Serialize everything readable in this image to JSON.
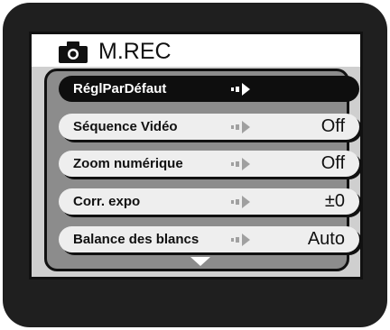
{
  "header": {
    "title": "M.REC",
    "icon": "camera-icon"
  },
  "menu": {
    "items": [
      {
        "label": "RéglParDéfaut",
        "value": "",
        "selected": true
      },
      {
        "label": "Séquence Vidéo",
        "value": "Off",
        "selected": false
      },
      {
        "label": "Zoom numérique",
        "value": "Off",
        "selected": false
      },
      {
        "label": "Corr. expo",
        "value": "±0",
        "selected": false
      },
      {
        "label": "Balance des blancs",
        "value": "Auto",
        "selected": false
      }
    ],
    "more_indicator": "down-triangle-icon"
  },
  "colors": {
    "bezel": "#1f1f1f",
    "panel": "#8c8c8c",
    "row": "#eeeeee",
    "selected_row": "#0e0e0e",
    "arrow_active": "#ffffff",
    "arrow_inactive": "#a0a0a0"
  }
}
